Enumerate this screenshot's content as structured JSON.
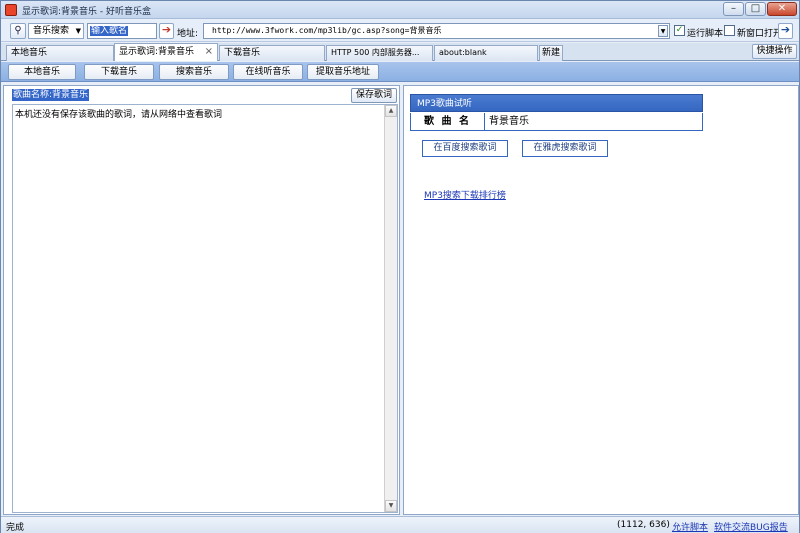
{
  "window": {
    "title": "显示歌词:背景音乐 - 好听音乐盒",
    "controls": {
      "minimize": "–",
      "maximize": "□",
      "close": "✕"
    }
  },
  "toolbar": {
    "search_engine": "音乐搜索",
    "query_value": "输入歌名",
    "go_glyph": "➔",
    "address_label": "地址:",
    "address_value": "http://www.3fwork.com/mp3lib/gc.asp?song=背景音乐",
    "run_script_label": "运行脚本",
    "run_script_checked": true,
    "new_window_label": "新窗口打开",
    "new_window_checked": false,
    "go2_glyph": "➔"
  },
  "tabs": [
    {
      "label": "本地音乐",
      "active": false
    },
    {
      "label": "显示歌词:背景音乐",
      "active": true
    },
    {
      "label": "下载音乐",
      "active": false
    },
    {
      "label": "HTTP 500 内部服务器...",
      "active": false
    },
    {
      "label": "about:blank",
      "active": false
    },
    {
      "label": "新建",
      "active": false
    }
  ],
  "tab_close_glyph": "×",
  "quick_op_label": "快捷操作",
  "nav": [
    "本地音乐",
    "下载音乐",
    "搜索音乐",
    "在线听音乐",
    "提取音乐地址"
  ],
  "left": {
    "song_name": "歌曲名称:背景音乐",
    "save_label": "保存歌词",
    "lyrics_text": "本机还没有保存该歌曲的歌词，请从网络中查看歌词"
  },
  "right": {
    "header": "MP3歌曲试听",
    "song_label": "歌 曲 名",
    "song_value": "背景音乐",
    "baidu_btn": "在百度搜索歌词",
    "yahoo_btn": "在雅虎搜索歌词",
    "rank_link": "MP3搜索下载排行榜"
  },
  "status": {
    "text": "完成",
    "coords": "(1112, 636)",
    "allow_script": "允许脚本",
    "bug_report": "软件交流BUG报告"
  },
  "colors": {
    "accent": "#3567c2",
    "nav_bar": "#8bb0e3",
    "link": "#1c37b5"
  }
}
